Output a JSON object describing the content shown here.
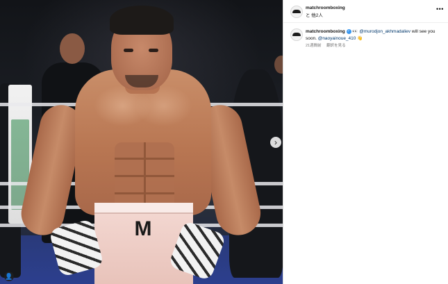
{
  "post": {
    "header": {
      "username": "matchroomboxing",
      "with_text": "と 他2人",
      "more_icon": "ellipsis-icon"
    },
    "caption": {
      "username": "matchroomboxing",
      "verified_badge": "✓",
      "eyes_emoji": "👀",
      "mention_1": "@murodjon_akhmadaliev",
      "text_1": "will see you soon.",
      "mention_2": "@naoyainoue_410",
      "wave_emoji": "👋"
    },
    "meta": {
      "time_ago": "21週間前",
      "translate_label": "翻訳を見る"
    },
    "photo": {
      "trunks_logo": "M",
      "next_icon": "chevron-right-icon",
      "next_glyph": "›",
      "tags_icon": "person-tag-icon",
      "tags_glyph": "👤"
    }
  },
  "colors": {
    "mention": "#00376b",
    "verified": "#3897f0",
    "meta_text": "#737373"
  }
}
